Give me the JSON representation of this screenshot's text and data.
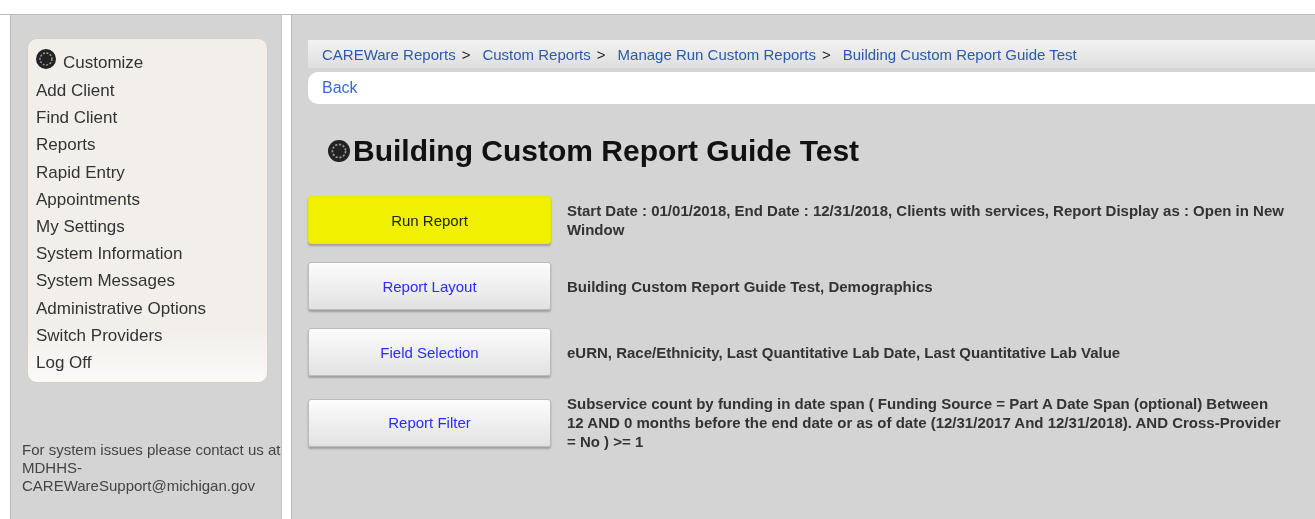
{
  "sidebar": {
    "items": [
      {
        "label": "Customize",
        "kind": "icon"
      },
      {
        "label": "Add Client",
        "kind": "plain"
      },
      {
        "label": "Find Client",
        "kind": "plain"
      },
      {
        "label": "Reports",
        "kind": "plain"
      },
      {
        "label": "Rapid Entry",
        "kind": "plain"
      },
      {
        "label": "Appointments",
        "kind": "plain"
      },
      {
        "label": "My Settings",
        "kind": "plain"
      },
      {
        "label": "System Information",
        "kind": "plain"
      },
      {
        "label": "System Messages",
        "kind": "plain"
      },
      {
        "label": "Administrative Options",
        "kind": "plain"
      },
      {
        "label": "Switch Providers",
        "kind": "plain"
      },
      {
        "label": "Log Off",
        "kind": "plain"
      }
    ],
    "footer": "For system issues please contact us at MDHHS-CAREWareSupport@michigan.gov"
  },
  "breadcrumbs": [
    "CAREWare Reports",
    "Custom Reports",
    "Manage Run Custom Reports",
    "Building Custom Report Guide Test"
  ],
  "breadcrumb_separator": ">",
  "back_link": "Back",
  "page_title": "Building Custom Report Guide Test",
  "steps": [
    {
      "button": "Run Report",
      "highlighted": true,
      "description": "Start Date : 01/01/2018, End Date : 12/31/2018, Clients with services, Report Display as : Open in New Window"
    },
    {
      "button": "Report Layout",
      "highlighted": false,
      "description": "Building Custom Report Guide Test, Demographics"
    },
    {
      "button": "Field Selection",
      "highlighted": false,
      "description": "eURN, Race/Ethnicity, Last Quantitative Lab Date, Last Quantitative Lab Value"
    },
    {
      "button": "Report Filter",
      "highlighted": false,
      "description": "Subservice count by funding in date span ( Funding Source = Part A Date Span (optional) Between 12 AND 0 months before the end date or as of date (12/31/2017 And 12/31/2018). AND Cross-Provider = No ) >= 1"
    }
  ]
}
